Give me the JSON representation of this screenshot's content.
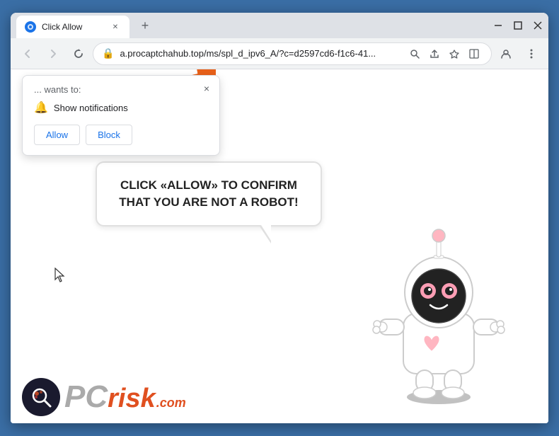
{
  "window": {
    "title": "Click Allow",
    "tab_label": "Click Allow",
    "close_label": "×",
    "minimize_label": "─",
    "maximize_label": "□",
    "controls_min": "─",
    "controls_max": "□",
    "controls_close": "✕"
  },
  "navbar": {
    "back_icon": "←",
    "forward_icon": "→",
    "reload_icon": "↻",
    "url": "a.procaptchahub.top/ms/spl_d_ipv6_A/?c=d2597cd6-f1c6-41...",
    "search_icon": "🔍",
    "share_icon": "⤴",
    "bookmark_icon": "☆",
    "split_icon": "▱",
    "profile_icon": "👤",
    "menu_icon": "⋮"
  },
  "notification": {
    "wants_text": "... wants to:",
    "notification_text": "Show notifications",
    "allow_label": "Allow",
    "block_label": "Block",
    "close_icon": "×"
  },
  "page": {
    "headline": "CLICK «ALLOW» TO CONFIRM THAT YOU ARE NOT A ROBOT!"
  },
  "pcrisk": {
    "text": "PC",
    "suffix": "risk",
    "com": ".com"
  },
  "colors": {
    "orange": "#e8611a",
    "blue": "#1a73e8",
    "text_dark": "#202124"
  }
}
